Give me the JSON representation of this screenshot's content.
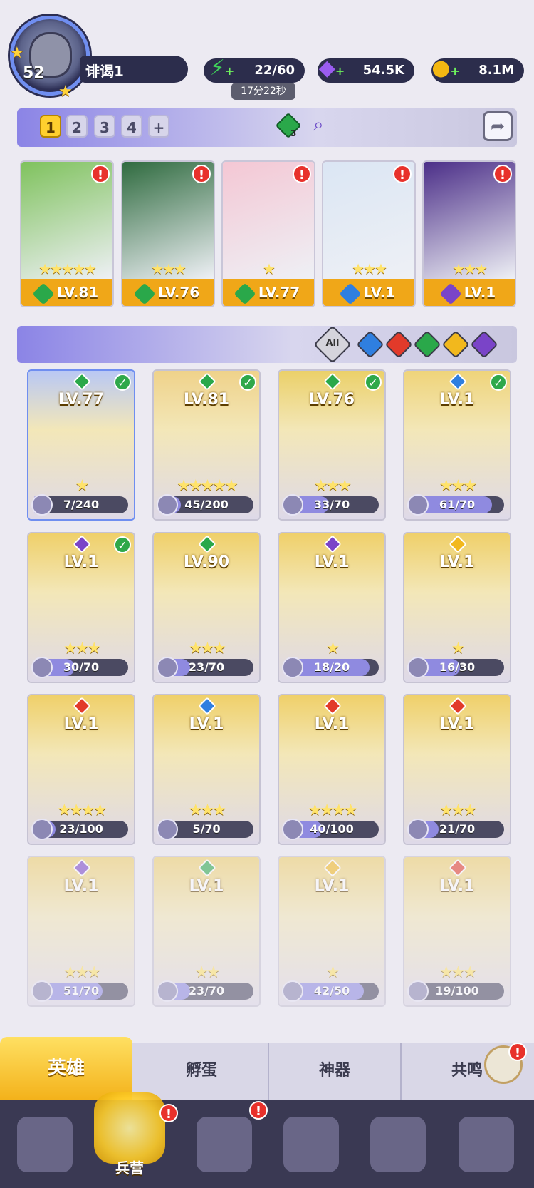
{
  "player": {
    "level": "52",
    "name": "诽谒1"
  },
  "resources": {
    "energy": {
      "value": "22/60",
      "timer": "17分22秒",
      "icon": "lightning-icon"
    },
    "gems": {
      "value": "54.5K",
      "icon": "diamond-icon"
    },
    "coins": {
      "value": "8.1M",
      "icon": "coin-icon"
    }
  },
  "team_slots": [
    "1",
    "2",
    "3",
    "4",
    "+"
  ],
  "team_badge": "3",
  "team": [
    {
      "level": "LV.81",
      "stars": "★★★★★",
      "element": "green",
      "alert": "!"
    },
    {
      "level": "LV.76",
      "stars": "★★★",
      "element": "green",
      "alert": "!"
    },
    {
      "level": "LV.77",
      "stars": "★",
      "element": "green",
      "alert": "!"
    },
    {
      "level": "LV.1",
      "stars": "★★★",
      "element": "blue",
      "alert": "!"
    },
    {
      "level": "LV.1",
      "stars": "★★★",
      "element": "purple",
      "alert": "!"
    }
  ],
  "filters": {
    "all_label": "All",
    "elements": [
      "blue",
      "red",
      "green",
      "yellow",
      "purple"
    ]
  },
  "colors": {
    "blue": "#2f7fe0",
    "red": "#e23a2a",
    "green": "#2aa84a",
    "yellow": "#f2b81d",
    "purple": "#7a44c8",
    "accent": "#ffcf2e"
  },
  "heroes": [
    {
      "level": "LV.77",
      "progress": "7/240",
      "stars": "★",
      "element": "green",
      "owned": true,
      "tint": "#b9c8f4"
    },
    {
      "level": "LV.81",
      "progress": "45/200",
      "stars": "★★★★★",
      "element": "green",
      "owned": true,
      "tint": "#efd28a"
    },
    {
      "level": "LV.76",
      "progress": "33/70",
      "stars": "★★★",
      "element": "green",
      "owned": true,
      "tint": "#ebd069"
    },
    {
      "level": "LV.1",
      "progress": "61/70",
      "stars": "★★★",
      "element": "blue",
      "owned": true,
      "tint": "#efd47a"
    },
    {
      "level": "LV.1",
      "progress": "30/70",
      "stars": "★★★",
      "element": "purple",
      "owned": true,
      "tint": "#efd06a"
    },
    {
      "level": "LV.90",
      "progress": "23/70",
      "stars": "★★★",
      "element": "green",
      "owned": true,
      "tint": "#efd06a"
    },
    {
      "level": "LV.1",
      "progress": "18/20",
      "stars": "★",
      "element": "purple",
      "owned": true,
      "tint": "#efd06a"
    },
    {
      "level": "LV.1",
      "progress": "16/30",
      "stars": "★",
      "element": "yellow",
      "owned": true,
      "tint": "#efd06a"
    },
    {
      "level": "LV.1",
      "progress": "23/100",
      "stars": "★★★★",
      "element": "red",
      "owned": true,
      "tint": "#efd06a"
    },
    {
      "level": "LV.1",
      "progress": "5/70",
      "stars": "★★★",
      "element": "blue",
      "owned": true,
      "tint": "#efd06a"
    },
    {
      "level": "LV.1",
      "progress": "40/100",
      "stars": "★★★★",
      "element": "red",
      "owned": true,
      "tint": "#efd06a"
    },
    {
      "level": "LV.1",
      "progress": "21/70",
      "stars": "★★★",
      "element": "red",
      "owned": true,
      "tint": "#efd06a"
    },
    {
      "level": "LV.1",
      "progress": "51/70",
      "stars": "★★★",
      "element": "purple",
      "owned": false,
      "tint": "#efd06a"
    },
    {
      "level": "LV.1",
      "progress": "23/70",
      "stars": "★★",
      "element": "green",
      "owned": false,
      "tint": "#efd06a"
    },
    {
      "level": "LV.1",
      "progress": "42/50",
      "stars": "★",
      "element": "yellow",
      "owned": false,
      "tint": "#efd06a"
    },
    {
      "level": "LV.1",
      "progress": "19/100",
      "stars": "★★★",
      "element": "red",
      "owned": false,
      "tint": "#efd06a"
    }
  ],
  "sub_tabs": [
    "英雄",
    "孵蛋",
    "神器",
    "共鸣"
  ],
  "nav": {
    "barracks_label": "兵营",
    "alert": "!"
  }
}
